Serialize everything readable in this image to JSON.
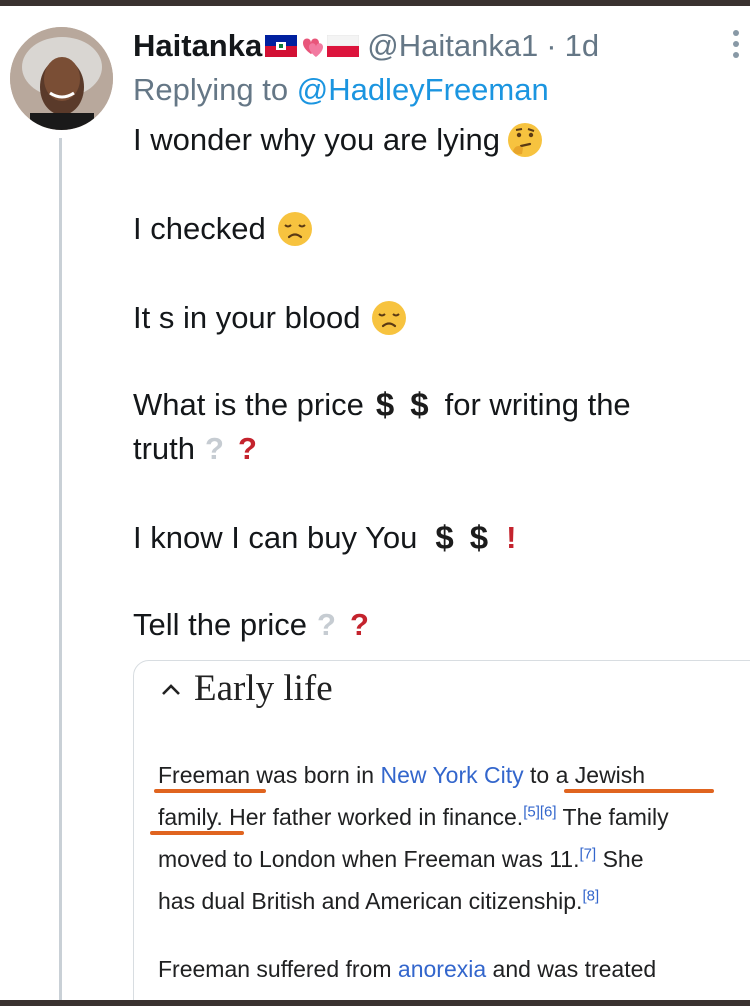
{
  "tweet": {
    "display_name": "Haitanka",
    "flags": [
      "haiti-flag-icon",
      "heart-ribbon-icon",
      "poland-flag-icon"
    ],
    "handle": "@Haitanka1",
    "separator": "·",
    "time": "1d",
    "reply_prefix": "Replying to",
    "reply_to": "@HadleyFreeman",
    "lines": {
      "l1": "I wonder why you are lying",
      "l2": "I checked",
      "l3": "It s in your blood",
      "l4a": "What is the price",
      "l4b": "for writing the",
      "l5": "truth",
      "l6": "I know I can buy You",
      "l7": "Tell the price"
    },
    "symbols": {
      "dollar": "$",
      "question": "?",
      "exclamation": "!"
    }
  },
  "wiki": {
    "section_title": "Early life",
    "p1": {
      "s1": "Freeman",
      "s2": " was born in ",
      "s3": "New York City",
      "s4": " to a ",
      "s5": "Jewish",
      "s6": "family",
      "s7": ". Her father worked in finance.",
      "s8": "[5][6]",
      "s9": " The family",
      "s10": "moved to London when Freeman was 11.",
      "s11": "[7]",
      "s12": " She",
      "s13": "has dual British and American citizenship.",
      "s14": "[8]"
    },
    "p2": {
      "s1": "Freeman suffered from ",
      "s2": "anorexia",
      "s3": " and was treated"
    }
  },
  "colors": {
    "link": "#1b95e0",
    "wiki_link": "#3366cc",
    "underline": "#e0641f",
    "red_mark": "#c4232d"
  }
}
